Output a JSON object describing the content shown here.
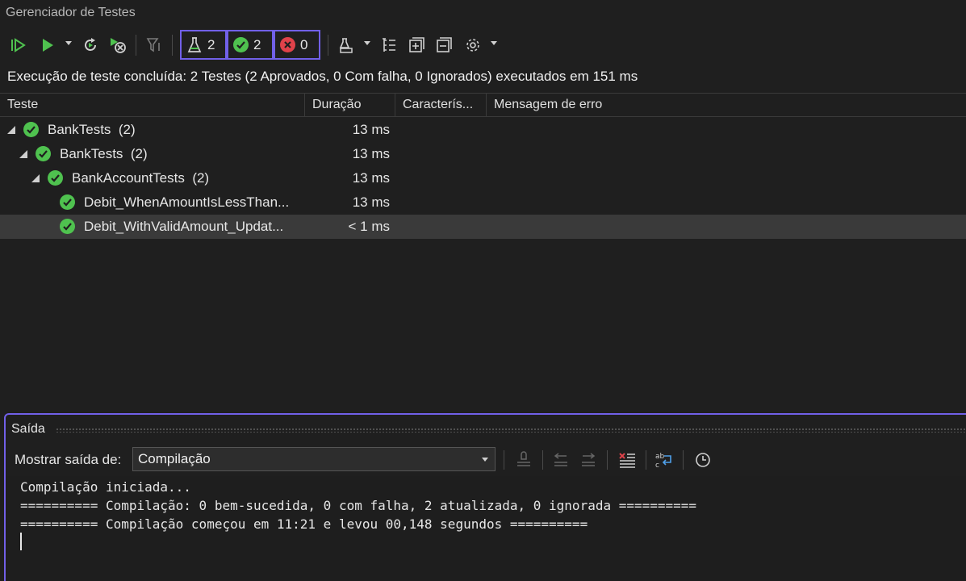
{
  "window": {
    "title": "Gerenciador de Testes"
  },
  "toolbar": {
    "counters": {
      "total": "2",
      "passed": "2",
      "failed": "0"
    }
  },
  "status": {
    "text": "Execução de teste concluída: 2 Testes (2 Aprovados, 0 Com falha, 0 Ignorados) executados em 151 ms"
  },
  "grid": {
    "columns": [
      "Teste",
      "Duração",
      "Caracterís...",
      "Mensagem de erro"
    ],
    "rows": [
      {
        "label": "BankTests",
        "count": "(2)",
        "duration": "13 ms",
        "level": 0,
        "expanded": true
      },
      {
        "label": "BankTests",
        "count": "(2)",
        "duration": "13 ms",
        "level": 1,
        "expanded": true
      },
      {
        "label": "BankAccountTests",
        "count": "(2)",
        "duration": "13 ms",
        "level": 2,
        "expanded": true
      },
      {
        "label": "Debit_WhenAmountIsLessThan...",
        "count": "",
        "duration": "13 ms",
        "level": 3,
        "expanded": false
      },
      {
        "label": "Debit_WithValidAmount_Updat...",
        "count": "",
        "duration": "< 1 ms",
        "level": 3,
        "expanded": false,
        "selected": true
      }
    ]
  },
  "output": {
    "title": "Saída",
    "show_label": "Mostrar saída de:",
    "source": "Compilação",
    "lines": [
      "Compilação iniciada...",
      "========== Compilação: 0 bem-sucedida, 0 com falha, 2 atualizada, 0 ignorada ==========",
      "========== Compilação começou em 11:21 e levou 00,148 segundos =========="
    ]
  },
  "colors": {
    "accent": "#7160e8",
    "passed": "#4fc24f",
    "failed": "#e0424a"
  }
}
